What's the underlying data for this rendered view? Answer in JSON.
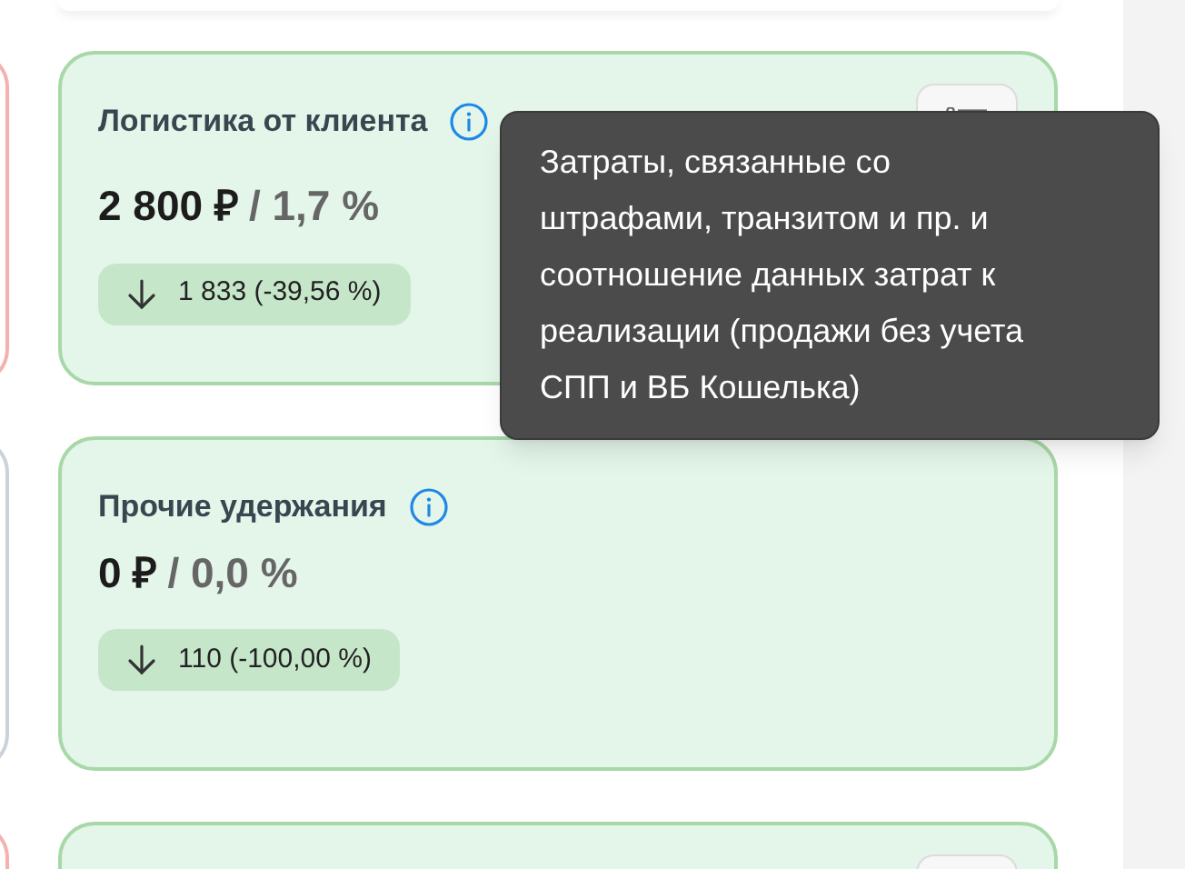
{
  "side_cards": [
    {
      "color": "#f5b1ad"
    },
    {
      "color": "#c9d3dc"
    },
    {
      "color": "#f5b1ad"
    }
  ],
  "cards": [
    {
      "title": "Логистика от клиента",
      "amount": "2 800 ₽",
      "percent": "/ 1,7 %",
      "change": "1 833 (-39,56 %)",
      "kind": "down",
      "has_menu": true
    },
    {
      "title": "Прочие удержания",
      "amount": "0 ₽",
      "percent": "/ 0,0 %",
      "change": "110 (-100,00 %)",
      "kind": "down",
      "has_menu": false
    },
    {
      "has_menu": true
    }
  ],
  "tooltip": {
    "text": "Затраты, связанные со штрафами, транзитом и пр. и соотношение данных затрат к реализации (продажи без учета СПП и ВБ Кошелька)"
  }
}
